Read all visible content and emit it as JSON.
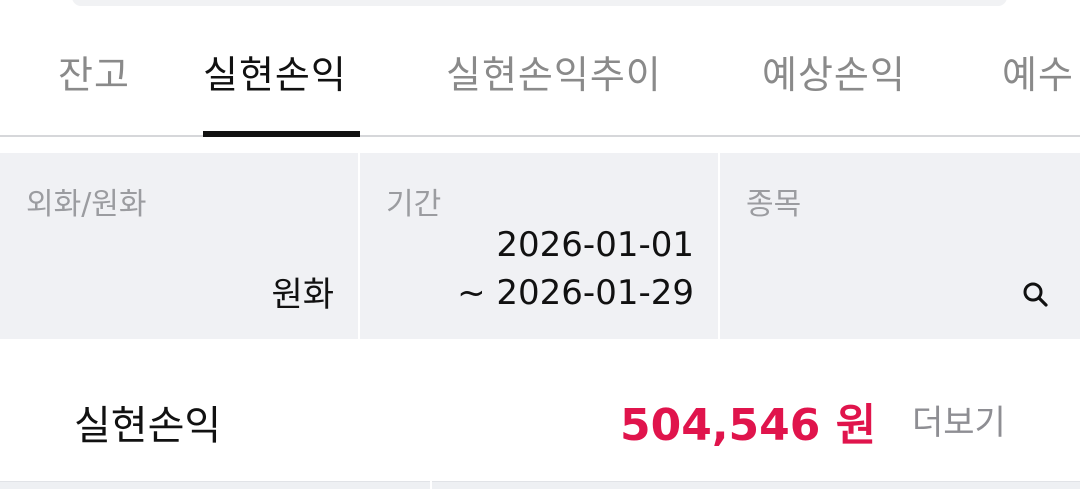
{
  "tabs": [
    {
      "label": "잔고",
      "active": false
    },
    {
      "label": "실현손익",
      "active": true
    },
    {
      "label": "실현손익추이",
      "active": false
    },
    {
      "label": "예상손익",
      "active": false
    },
    {
      "label": "예수",
      "active": false
    }
  ],
  "filters": {
    "currency": {
      "label": "외화/원화",
      "value": "원화"
    },
    "period": {
      "label": "기간",
      "start": "2026-01-01",
      "end": "~ 2026-01-29"
    },
    "stock": {
      "label": "종목",
      "icon": "search-icon"
    }
  },
  "summary": {
    "label": "실현손익",
    "value": "504,546 원",
    "more_label": "더보기"
  },
  "colors": {
    "accent": "#e0144c",
    "tab_active": "#111111",
    "tab_inactive": "#8a8a8a",
    "filter_bg": "#f0f1f4"
  }
}
